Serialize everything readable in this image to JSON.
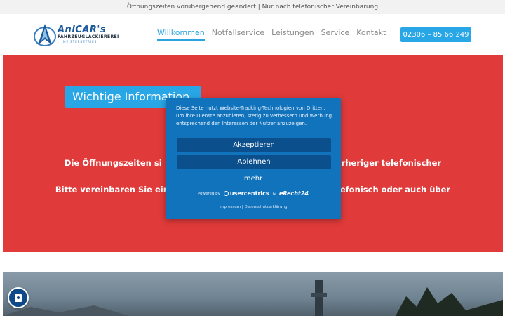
{
  "topbar": {
    "text": "Öffnungszeiten vorübergehend geändert | Nur nach telefonischer Vereinbarung"
  },
  "logo": {
    "name": "AniCAR's",
    "subtitle": "FAHRZEUGLACKIEREREI",
    "tagline": "MEISTERBETRIEB"
  },
  "nav": {
    "items": [
      "Willkommen",
      "Notfallservice",
      "Leistungen",
      "Service",
      "Kontakt"
    ],
    "active": "Willkommen"
  },
  "phone_button": {
    "label": "02306 – 85 66 249"
  },
  "hero": {
    "badge": "Wichtige Information",
    "line1_left": "Die Öffnungszeiten si",
    "line1_right": "rheriger telefonischer",
    "line2_left": "Bitte vereinbaren Sie ein",
    "line2_right": "efonisch oder auch über"
  },
  "cookie": {
    "text": "Diese Seite nutzt Website-Tracking-Technologien von Dritten, um ihre Dienste anzubieten, stetig zu verbessern und Werbung entsprechend den Interessen der Nutzer anzuzeigen.",
    "accept": "Akzeptieren",
    "decline": "Ablehnen",
    "more": "mehr",
    "powered_by": "Powered by",
    "usercentrics": "usercentrics",
    "ampersand": "&",
    "erecht": "eRecht24",
    "legal": "Impressum | Datenschutzerklärung"
  },
  "colors": {
    "accent": "#29a6e6",
    "hero_bg": "#e03a3a",
    "cookie_bg": "#1273bd",
    "cookie_btn": "#0b4f8c"
  }
}
